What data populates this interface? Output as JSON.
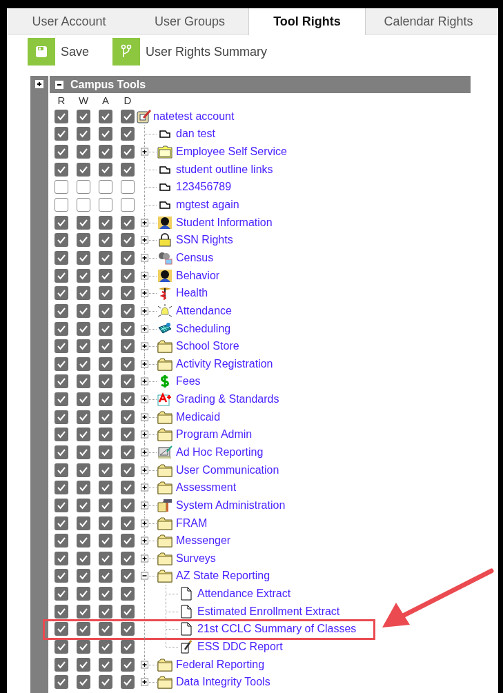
{
  "tabs": [
    {
      "label": "User Account",
      "selected": false
    },
    {
      "label": "User Groups",
      "selected": false
    },
    {
      "label": "Tool Rights",
      "selected": true
    },
    {
      "label": "Calendar Rights",
      "selected": false
    }
  ],
  "toolbar": [
    {
      "kind": "save",
      "label": "Save"
    },
    {
      "kind": "summary",
      "label": "User Rights Summary"
    }
  ],
  "sidebar": {
    "expanded": false
  },
  "section": {
    "title": "Campus Tools",
    "expanded": true
  },
  "columns": [
    "R",
    "W",
    "A",
    "D"
  ],
  "tree": {
    "label": "natetest account",
    "kind": "account",
    "checks": [
      true,
      true,
      true,
      true
    ],
    "children": [
      {
        "label": "dan test",
        "kind": "tab",
        "checks": [
          true,
          true,
          true,
          true
        ]
      },
      {
        "label": "Employee Self Service",
        "kind": "folder-yellow",
        "expanded": false,
        "checks": [
          true,
          true,
          true,
          true
        ]
      },
      {
        "label": "student outline links",
        "kind": "tab",
        "checks": [
          true,
          true,
          true,
          true
        ]
      },
      {
        "label": "123456789",
        "kind": "tab",
        "checks": [
          false,
          false,
          false,
          false
        ]
      },
      {
        "label": "mgtest again",
        "kind": "tab",
        "checks": [
          false,
          false,
          false,
          false
        ]
      },
      {
        "label": "Student Information",
        "kind": "person",
        "expanded": false,
        "checks": [
          true,
          true,
          true,
          true
        ]
      },
      {
        "label": "SSN Rights",
        "kind": "lock",
        "expanded": false,
        "checks": [
          true,
          true,
          true,
          true
        ]
      },
      {
        "label": "Census",
        "kind": "people",
        "expanded": false,
        "checks": [
          true,
          true,
          true,
          true
        ]
      },
      {
        "label": "Behavior",
        "kind": "person",
        "expanded": false,
        "checks": [
          true,
          true,
          true,
          true
        ]
      },
      {
        "label": "Health",
        "kind": "health",
        "expanded": false,
        "checks": [
          true,
          true,
          true,
          true
        ]
      },
      {
        "label": "Attendance",
        "kind": "bell",
        "expanded": false,
        "checks": [
          true,
          true,
          true,
          true
        ]
      },
      {
        "label": "Scheduling",
        "kind": "grid",
        "expanded": false,
        "checks": [
          true,
          true,
          true,
          true
        ]
      },
      {
        "label": "School Store",
        "kind": "folder",
        "expanded": false,
        "checks": [
          true,
          true,
          true,
          true
        ]
      },
      {
        "label": "Activity Registration",
        "kind": "folder",
        "expanded": false,
        "checks": [
          true,
          true,
          true,
          true
        ]
      },
      {
        "label": "Fees",
        "kind": "dollar",
        "expanded": false,
        "checks": [
          true,
          true,
          true,
          true
        ]
      },
      {
        "label": "Grading & Standards",
        "kind": "grade",
        "expanded": false,
        "checks": [
          true,
          true,
          true,
          true
        ]
      },
      {
        "label": "Medicaid",
        "kind": "folder",
        "expanded": false,
        "checks": [
          true,
          true,
          true,
          true
        ]
      },
      {
        "label": "Program Admin",
        "kind": "folder",
        "expanded": false,
        "checks": [
          true,
          true,
          true,
          true
        ]
      },
      {
        "label": "Ad Hoc Reporting",
        "kind": "report",
        "expanded": false,
        "checks": [
          true,
          true,
          true,
          true
        ]
      },
      {
        "label": "User Communication",
        "kind": "folder",
        "expanded": false,
        "checks": [
          true,
          true,
          true,
          true
        ]
      },
      {
        "label": "Assessment",
        "kind": "folder",
        "expanded": false,
        "checks": [
          true,
          true,
          true,
          true
        ]
      },
      {
        "label": "System Administration",
        "kind": "tools",
        "expanded": false,
        "checks": [
          true,
          true,
          true,
          true
        ]
      },
      {
        "label": "FRAM",
        "kind": "folder",
        "expanded": false,
        "checks": [
          true,
          true,
          true,
          true
        ]
      },
      {
        "label": "Messenger",
        "kind": "folder",
        "expanded": false,
        "checks": [
          true,
          true,
          true,
          true
        ]
      },
      {
        "label": "Surveys",
        "kind": "folder",
        "expanded": false,
        "checks": [
          true,
          true,
          true,
          true
        ]
      },
      {
        "label": "AZ State Reporting",
        "kind": "folder",
        "expanded": true,
        "checks": [
          true,
          true,
          true,
          true
        ],
        "children": [
          {
            "label": "Attendance Extract",
            "kind": "document",
            "highlighted": false,
            "checks": [
              true,
              true,
              true,
              true
            ]
          },
          {
            "label": "Estimated Enrollment Extract",
            "kind": "document",
            "highlighted": false,
            "checks": [
              true,
              true,
              true,
              true
            ]
          },
          {
            "label": "21st CCLC Summary of Classes",
            "kind": "document",
            "highlighted": true,
            "checks": [
              true,
              true,
              true,
              true
            ]
          },
          {
            "label": "ESS DDC Report",
            "kind": "note",
            "highlighted": false,
            "checks": [
              true,
              true,
              true,
              true
            ]
          }
        ]
      },
      {
        "label": "Federal Reporting",
        "kind": "folder",
        "expanded": false,
        "checks": [
          true,
          true,
          true,
          true
        ]
      },
      {
        "label": "Data Integrity Tools",
        "kind": "folder",
        "expanded": false,
        "checks": [
          true,
          true,
          true,
          true
        ]
      }
    ]
  }
}
